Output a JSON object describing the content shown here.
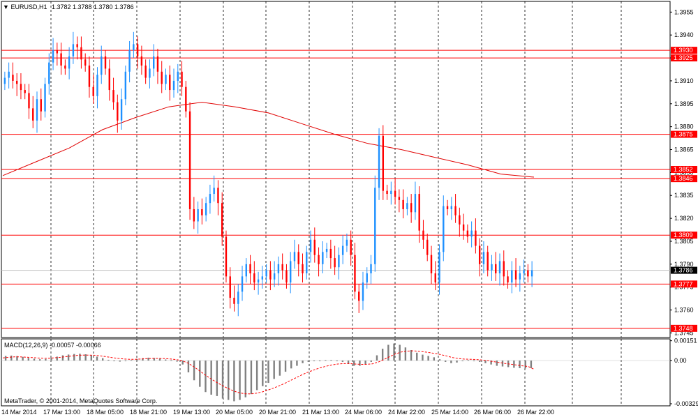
{
  "header": {
    "symbol": "EURUSD,H1",
    "ohlc": "1.3782 1.3788 1.3780 1.3786",
    "indicator": "MACD(12,26,9) -0.00057 -0.00066",
    "copyright": "MetaTrader, © 2001-2014, MetaQuotes Software Corp."
  },
  "colors": {
    "bull": "#1e90ff",
    "bear": "#ff0000",
    "level_line": "#ff0000",
    "ma_line": "#e00000",
    "grid": "#000000",
    "macd_hist": "#808080",
    "macd_signal": "#ff0000",
    "price_tag_bg": "#ff0000",
    "current_tag_bg": "#000000"
  },
  "chart_data": {
    "type": "candlestick",
    "price_axis": [
      "1.3955",
      "1.3940",
      "1.3925",
      "1.3910",
      "1.3895",
      "1.3880",
      "1.3865",
      "1.3850",
      "1.3835",
      "1.3820",
      "1.3805",
      "1.3790",
      "1.3775",
      "1.3760",
      "1.3745"
    ],
    "ylim": [
      1.3742,
      1.3962
    ],
    "time_axis": [
      "14 Mar 2014",
      "17 Mar 13:00",
      "18 Mar 05:00",
      "18 Mar 21:00",
      "19 Mar 13:00",
      "20 Mar 05:00",
      "20 Mar 21:00",
      "21 Mar 13:00",
      "24 Mar 06:00",
      "24 Mar 22:00",
      "25 Mar 14:00",
      "26 Mar 06:00",
      "26 Mar 22:00"
    ],
    "levels": [
      "1.3930",
      "1.3925",
      "1.3875",
      "1.3852",
      "1.3846",
      "1.3809",
      "1.3777",
      "1.3748"
    ],
    "current_price": "1.3786",
    "moving_average": [
      1.3848,
      1.3857,
      1.3866,
      1.3878,
      1.3886,
      1.3893,
      1.3896,
      1.3893,
      1.3889,
      1.3882,
      1.3875,
      1.3869,
      1.3865,
      1.386,
      1.3855,
      1.3849,
      1.3847
    ],
    "candles": [
      [
        1.3908,
        1.3912
      ],
      [
        1.3912,
        1.3916
      ],
      [
        1.3914,
        1.391
      ],
      [
        1.391,
        1.3908
      ],
      [
        1.3908,
        1.3904
      ],
      [
        1.3904,
        1.3902
      ],
      [
        1.3902,
        1.3892
      ],
      [
        1.3892,
        1.3884
      ],
      [
        1.3884,
        1.3898
      ],
      [
        1.3898,
        1.389
      ],
      [
        1.389,
        1.3908
      ],
      [
        1.3908,
        1.3922
      ],
      [
        1.3922,
        1.393
      ],
      [
        1.393,
        1.3928
      ],
      [
        1.3928,
        1.392
      ],
      [
        1.392,
        1.3918
      ],
      [
        1.3918,
        1.3926
      ],
      [
        1.3926,
        1.3934
      ],
      [
        1.3934,
        1.3932
      ],
      [
        1.3932,
        1.3924
      ],
      [
        1.3924,
        1.392
      ],
      [
        1.392,
        1.3906
      ],
      [
        1.3906,
        1.39
      ],
      [
        1.39,
        1.3914
      ],
      [
        1.3914,
        1.3926
      ],
      [
        1.3926,
        1.3918
      ],
      [
        1.3918,
        1.3904
      ],
      [
        1.3904,
        1.3896
      ],
      [
        1.3896,
        1.3884
      ],
      [
        1.3884,
        1.3898
      ],
      [
        1.3898,
        1.3916
      ],
      [
        1.3916,
        1.393
      ],
      [
        1.393,
        1.3934
      ],
      [
        1.3934,
        1.3926
      ],
      [
        1.3926,
        1.392
      ],
      [
        1.392,
        1.3912
      ],
      [
        1.3912,
        1.3918
      ],
      [
        1.3918,
        1.3926
      ],
      [
        1.3926,
        1.3916
      ],
      [
        1.3916,
        1.3908
      ],
      [
        1.3908,
        1.3914
      ],
      [
        1.3914,
        1.3904
      ],
      [
        1.3904,
        1.391
      ],
      [
        1.391,
        1.3916
      ],
      [
        1.3916,
        1.3906
      ],
      [
        1.3906,
        1.389
      ],
      [
        1.389,
        1.3826
      ],
      [
        1.3826,
        1.3818
      ],
      [
        1.3818,
        1.3826
      ],
      [
        1.3826,
        1.3822
      ],
      [
        1.3822,
        1.383
      ],
      [
        1.383,
        1.3836
      ],
      [
        1.3836,
        1.384
      ],
      [
        1.384,
        1.383
      ],
      [
        1.383,
        1.3808
      ],
      [
        1.3808,
        1.3782
      ],
      [
        1.3782,
        1.3768
      ],
      [
        1.3768,
        1.3764
      ],
      [
        1.3764,
        1.3772
      ],
      [
        1.3772,
        1.3782
      ],
      [
        1.3782,
        1.379
      ],
      [
        1.379,
        1.3784
      ],
      [
        1.3784,
        1.3778
      ],
      [
        1.3778,
        1.378
      ],
      [
        1.378,
        1.3782
      ],
      [
        1.3782,
        1.3786
      ],
      [
        1.3786,
        1.378
      ],
      [
        1.378,
        1.3784
      ],
      [
        1.3784,
        1.379
      ],
      [
        1.379,
        1.3786
      ],
      [
        1.3786,
        1.3778
      ],
      [
        1.3778,
        1.3792
      ],
      [
        1.3792,
        1.3798
      ],
      [
        1.3798,
        1.379
      ],
      [
        1.379,
        1.3784
      ],
      [
        1.3784,
        1.3798
      ],
      [
        1.3798,
        1.3806
      ],
      [
        1.3806,
        1.3796
      ],
      [
        1.3796,
        1.379
      ],
      [
        1.379,
        1.3798
      ],
      [
        1.3798,
        1.38
      ],
      [
        1.38,
        1.3794
      ],
      [
        1.3794,
        1.3788
      ],
      [
        1.3788,
        1.3796
      ],
      [
        1.3796,
        1.3802
      ],
      [
        1.3802,
        1.3806
      ],
      [
        1.3806,
        1.3796
      ],
      [
        1.3796,
        1.3772
      ],
      [
        1.3772,
        1.3766
      ],
      [
        1.3766,
        1.3778
      ],
      [
        1.3778,
        1.3784
      ],
      [
        1.3784,
        1.379
      ],
      [
        1.379,
        1.384
      ],
      [
        1.384,
        1.3874
      ],
      [
        1.3874,
        1.3838
      ],
      [
        1.3838,
        1.3836
      ],
      [
        1.3836,
        1.3838
      ],
      [
        1.3838,
        1.3834
      ],
      [
        1.3834,
        1.3832
      ],
      [
        1.3832,
        1.3826
      ],
      [
        1.3826,
        1.383
      ],
      [
        1.383,
        1.3824
      ],
      [
        1.3824,
        1.3836
      ],
      [
        1.3836,
        1.3812
      ],
      [
        1.3812,
        1.3806
      ],
      [
        1.3806,
        1.3796
      ],
      [
        1.3796,
        1.3784
      ],
      [
        1.3784,
        1.3778
      ],
      [
        1.3778,
        1.3798
      ],
      [
        1.3798,
        1.3828
      ],
      [
        1.3828,
        1.3826
      ],
      [
        1.3826,
        1.3828
      ],
      [
        1.3828,
        1.3822
      ],
      [
        1.3822,
        1.3816
      ],
      [
        1.3816,
        1.3812
      ],
      [
        1.3812,
        1.3808
      ],
      [
        1.3808,
        1.3812
      ],
      [
        1.3812,
        1.3802
      ],
      [
        1.3802,
        1.379
      ],
      [
        1.379,
        1.3798
      ],
      [
        1.3798,
        1.3786
      ],
      [
        1.3786,
        1.379
      ],
      [
        1.379,
        1.3784
      ],
      [
        1.3784,
        1.3792
      ],
      [
        1.3792,
        1.3782
      ],
      [
        1.3782,
        1.3778
      ],
      [
        1.3778,
        1.3786
      ],
      [
        1.3786,
        1.378
      ],
      [
        1.378,
        1.3784
      ],
      [
        1.3784,
        1.3786
      ],
      [
        1.3786,
        1.3782
      ],
      [
        1.3782,
        1.3786
      ]
    ],
    "macd": {
      "axis": [
        "0.00151",
        "0.00",
        "-0.00329"
      ],
      "ylim": [
        -0.00345,
        0.00165
      ],
      "histogram": [
        0.00035,
        0.00038,
        0.00034,
        0.00028,
        0.0002,
        0.00014,
        0.0001,
        0.00012,
        0.0002,
        0.0003,
        0.0004,
        0.00046,
        0.0005,
        0.00052,
        0.00048,
        0.0004,
        0.0003,
        0.00018,
        6e-05,
        -4e-05,
        -8e-05,
        -4e-05,
        4e-05,
        0.00012,
        0.00018,
        0.00022,
        0.0002,
        0.00014,
        8e-05,
        2e-05,
        -8e-05,
        -0.0003,
        -0.0009,
        -0.0015,
        -0.002,
        -0.0024,
        -0.0026,
        -0.0027,
        -0.0029,
        -0.003,
        -0.0031,
        -0.003,
        -0.0028,
        -0.00255,
        -0.00225,
        -0.00195,
        -0.0017,
        -0.0014,
        -0.00115,
        -0.00085,
        -0.0006,
        -0.0004,
        -0.0002,
        -0.0001,
        -5e-05,
        0.0,
        4e-05,
        4e-05,
        0.0,
        -0.0001,
        -0.00025,
        -0.0004,
        -0.0004,
        -0.0003,
        -0.0001,
        0.0004,
        0.0009,
        0.0012,
        0.0013,
        0.0012,
        0.001,
        0.0008,
        0.0006,
        0.00045,
        0.00035,
        0.00025,
        0.0001,
        -0.0001,
        -0.0002,
        -0.00015,
        -5e-05,
        4e-05,
        0.0,
        -0.0001,
        -0.0002,
        -0.0003,
        -0.0004,
        -0.00045,
        -0.0005,
        -0.00055,
        -0.00058,
        -0.0006,
        -0.00057
      ],
      "signal": [
        0.0002,
        0.00025,
        0.00028,
        0.00028,
        0.00026,
        0.00023,
        0.0002,
        0.00018,
        0.00018,
        0.00021,
        0.00025,
        0.0003,
        0.00035,
        0.0004,
        0.00042,
        0.00042,
        0.0004,
        0.00035,
        0.00029,
        0.00022,
        0.00016,
        0.00012,
        0.0001,
        0.0001,
        0.00012,
        0.00015,
        0.00016,
        0.00016,
        0.00015,
        0.00012,
        8e-05,
        0.0,
        -0.00018,
        -0.00045,
        -0.00075,
        -0.00108,
        -0.00138,
        -0.00165,
        -0.0019,
        -0.00212,
        -0.00232,
        -0.00246,
        -0.00253,
        -0.00254,
        -0.00248,
        -0.00238,
        -0.00224,
        -0.00208,
        -0.0019,
        -0.0017,
        -0.00148,
        -0.00126,
        -0.00105,
        -0.00086,
        -0.0007,
        -0.00055,
        -0.00043,
        -0.00033,
        -0.00026,
        -0.00023,
        -0.00023,
        -0.00026,
        -0.00029,
        -0.00029,
        -0.00025,
        -0.00012,
        8e-05,
        0.0003,
        0.0005,
        0.00065,
        0.00072,
        0.00074,
        0.00071,
        0.00066,
        0.0006,
        0.00053,
        0.00044,
        0.00033,
        0.00022,
        0.00015,
        0.00011,
        0.0001,
        8e-05,
        4e-05,
        -1e-05,
        -8e-05,
        -0.00015,
        -0.00022,
        -0.00028,
        -0.00034,
        -0.0004,
        -0.00045,
        -0.00066
      ]
    }
  }
}
